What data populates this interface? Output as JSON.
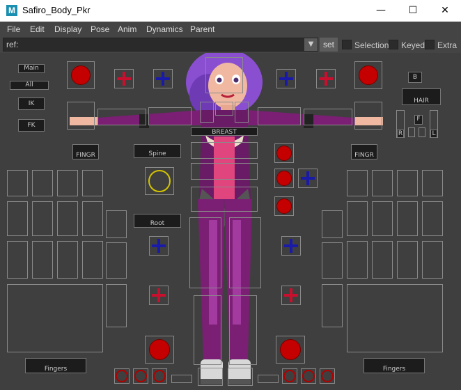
{
  "window": {
    "title": "Safiro_Body_Pkr",
    "logo_letter": "M",
    "minimize": "—",
    "maximize": "☐",
    "close": "✕"
  },
  "menu": [
    "File",
    "Edit",
    "Display",
    "Pose",
    "Anim",
    "Dynamics",
    "Parent"
  ],
  "ref": {
    "value": "ref:",
    "dropdown": "▼",
    "set_label": "set"
  },
  "toggles": [
    {
      "label": "Selection",
      "checked": false
    },
    {
      "label": "Keyed",
      "checked": false
    },
    {
      "label": "Extra",
      "checked": false
    }
  ],
  "picker": {
    "labels": {
      "main": "Main",
      "all": "All",
      "ik": "IK",
      "fk": "FK",
      "b": "B",
      "hair": "HAIR",
      "f": "F",
      "r": "R",
      "l": "L",
      "breast": "BREAST",
      "fingr_left": "FINGR",
      "fingr_right": "FINGR",
      "spine": "Spine",
      "root": "Root",
      "fingers_left": "Fingers",
      "fingers_right": "Fingers"
    },
    "colors": {
      "red": "#c40000",
      "red_plus": "#c8102e",
      "blue_plus": "#1a1aa8",
      "yellow": "#d4c400",
      "body_purple": "#7a1f73",
      "suit_pink": "#e0457e"
    }
  }
}
